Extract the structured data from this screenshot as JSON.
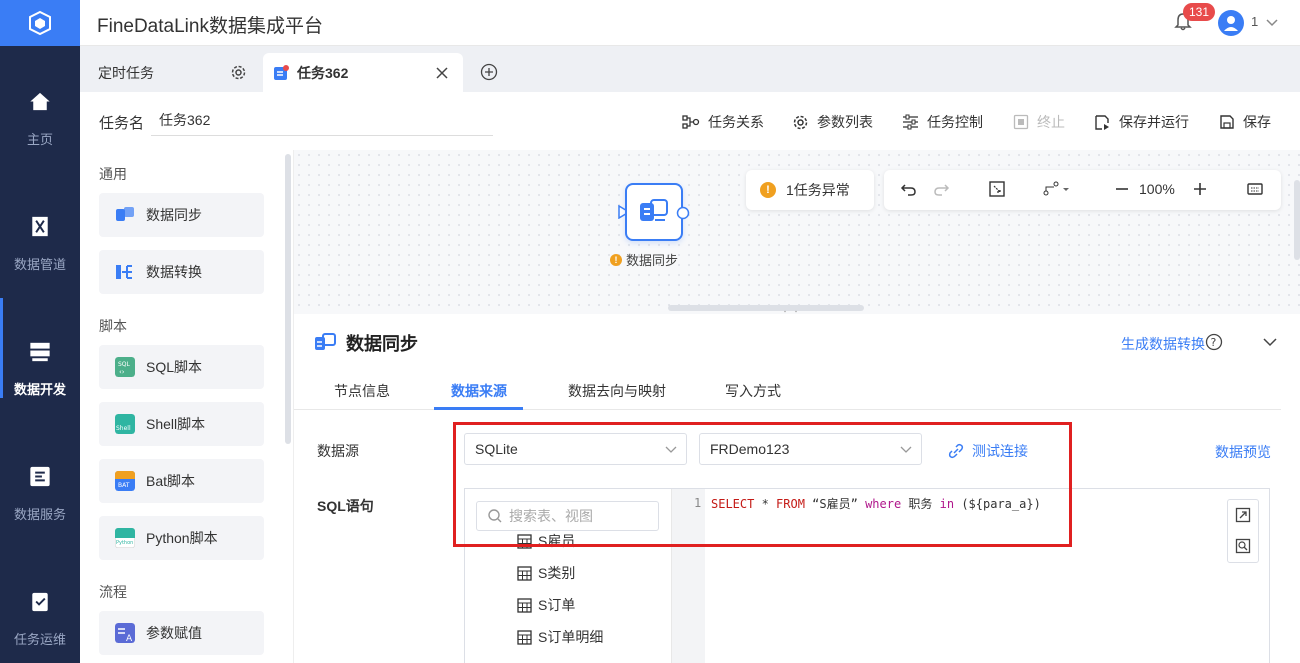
{
  "app": {
    "title": "FineDataLink数据集成平台"
  },
  "nav": {
    "items": [
      {
        "label": "主页",
        "icon": "home-icon"
      },
      {
        "label": "数据管道",
        "icon": "pipeline-icon"
      },
      {
        "label": "数据开发",
        "icon": "dev-icon",
        "active": true
      },
      {
        "label": "数据服务",
        "icon": "service-icon"
      },
      {
        "label": "任务运维",
        "icon": "ops-icon"
      }
    ]
  },
  "header": {
    "notification_count": "131",
    "user": "1"
  },
  "tabs": [
    {
      "label": "定时任务"
    },
    {
      "label": "任务362"
    }
  ],
  "task": {
    "name_label": "任务名",
    "name_value": "任务362",
    "toolbar": {
      "relations": "任务关系",
      "params": "参数列表",
      "control": "任务控制",
      "stop": "终止",
      "save_run": "保存并运行",
      "save": "保存"
    }
  },
  "palette": {
    "sections": [
      {
        "title": "通用",
        "items": [
          "数据同步",
          "数据转换"
        ]
      },
      {
        "title": "脚本",
        "items": [
          "SQL脚本",
          "Shell脚本",
          "Bat脚本",
          "Python脚本"
        ]
      },
      {
        "title": "流程",
        "items": [
          "参数赋值"
        ]
      }
    ]
  },
  "canvas": {
    "node_label": "数据同步",
    "alert": "1任务异常",
    "zoom": "100%"
  },
  "panel": {
    "title": "数据同步",
    "generate_link": "生成数据转换",
    "tabs": [
      "节点信息",
      "数据来源",
      "数据去向与映射",
      "写入方式"
    ],
    "active_tab": "数据来源",
    "datasource_label": "数据源",
    "datasource_type": "SQLite",
    "datasource_conn": "FRDemo123",
    "test_conn": "测试连接",
    "preview": "数据预览",
    "sql_label": "SQL语句",
    "search_placeholder": "搜索表、视图",
    "tree_items": [
      "S雇员",
      "S类别",
      "S订单",
      "S订单明细"
    ],
    "line_no": "1",
    "sql": {
      "select": "SELECT",
      "star": " * ",
      "from": "FROM",
      "table": " “S雇员” ",
      "where": "where",
      "col": " 职务 ",
      "in": "in",
      "param": " (${para_a})"
    }
  },
  "colors": {
    "accent": "#3a7df5",
    "nav_bg": "#1e2a4a",
    "highlight": "#e02020"
  }
}
